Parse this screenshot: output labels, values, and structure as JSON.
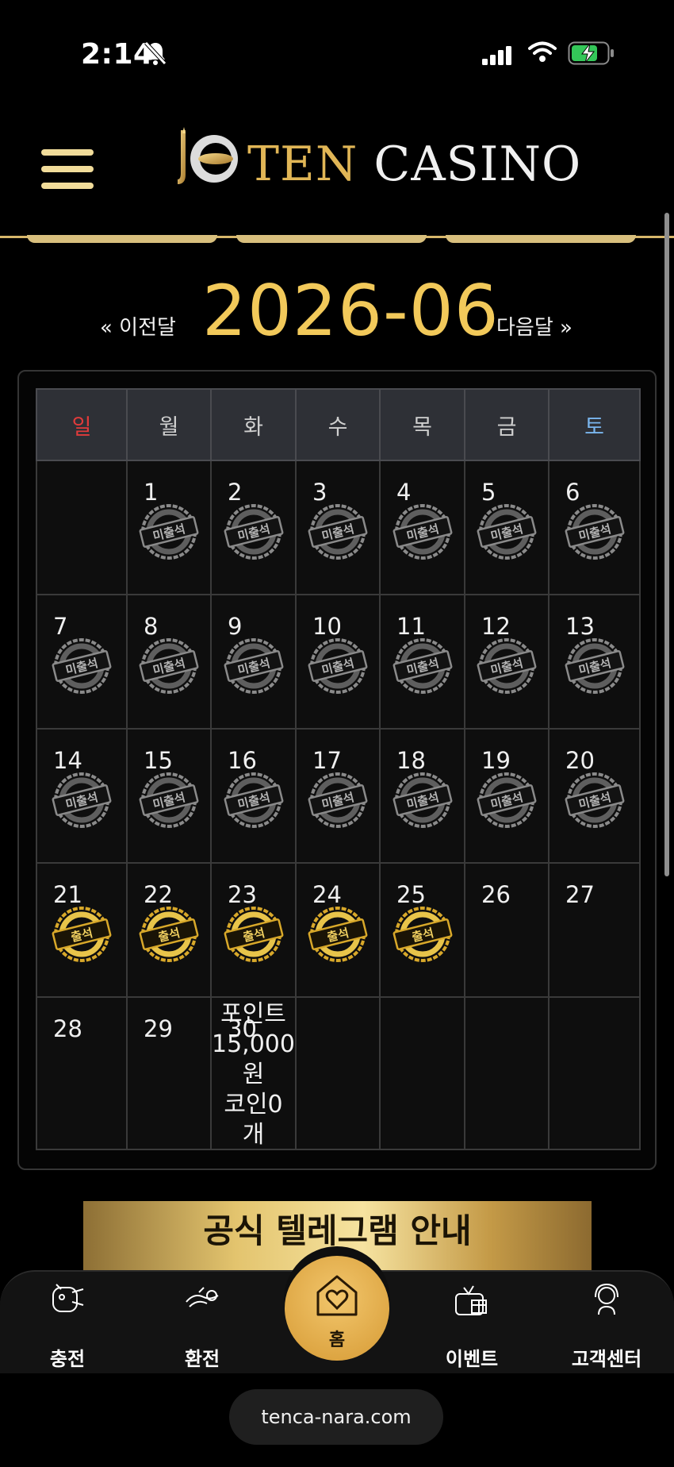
{
  "status_bar": {
    "time": "2:14",
    "battery_charging": true
  },
  "header": {
    "logo_part1": "TEN",
    "logo_part2": "CASINO",
    "brand_color": "#e1b656"
  },
  "calendar": {
    "prev_label": "« 이전달",
    "next_label": "다음달 »",
    "month": "2026-06",
    "weekdays": [
      "일",
      "월",
      "화",
      "수",
      "목",
      "금",
      "토"
    ],
    "absent_label": "미출석",
    "present_label": "출석",
    "point_text_line1": "포인트",
    "point_text_line2": "15,000",
    "point_text_line3": "원",
    "point_text_line4": "코인0",
    "point_text_line5": "개",
    "weeks": [
      [
        {
          "day": ""
        },
        {
          "day": "1",
          "stamp": "absent"
        },
        {
          "day": "2",
          "stamp": "absent"
        },
        {
          "day": "3",
          "stamp": "absent"
        },
        {
          "day": "4",
          "stamp": "absent"
        },
        {
          "day": "5",
          "stamp": "absent"
        },
        {
          "day": "6",
          "stamp": "absent"
        }
      ],
      [
        {
          "day": "7",
          "stamp": "absent"
        },
        {
          "day": "8",
          "stamp": "absent"
        },
        {
          "day": "9",
          "stamp": "absent"
        },
        {
          "day": "10",
          "stamp": "absent"
        },
        {
          "day": "11",
          "stamp": "absent"
        },
        {
          "day": "12",
          "stamp": "absent"
        },
        {
          "day": "13",
          "stamp": "absent"
        }
      ],
      [
        {
          "day": "14",
          "stamp": "absent"
        },
        {
          "day": "15",
          "stamp": "absent"
        },
        {
          "day": "16",
          "stamp": "absent"
        },
        {
          "day": "17",
          "stamp": "absent"
        },
        {
          "day": "18",
          "stamp": "absent"
        },
        {
          "day": "19",
          "stamp": "absent"
        },
        {
          "day": "20",
          "stamp": "absent"
        }
      ],
      [
        {
          "day": "21",
          "stamp": "present"
        },
        {
          "day": "22",
          "stamp": "present"
        },
        {
          "day": "23",
          "stamp": "present"
        },
        {
          "day": "24",
          "stamp": "present"
        },
        {
          "day": "25",
          "stamp": "present"
        },
        {
          "day": "26"
        },
        {
          "day": "27"
        }
      ],
      [
        {
          "day": "28"
        },
        {
          "day": "29"
        },
        {
          "day": "30"
        },
        {
          "day": ""
        },
        {
          "day": ""
        },
        {
          "day": ""
        },
        {
          "day": ""
        }
      ]
    ]
  },
  "banner": {
    "title": "공식 텔레그램 안내"
  },
  "bottom_nav": {
    "charge": "충전",
    "exchange": "환전",
    "home": "홈",
    "event": "이벤트",
    "support": "고객센터"
  },
  "url_bar": {
    "url": "tenca-nara.com"
  }
}
